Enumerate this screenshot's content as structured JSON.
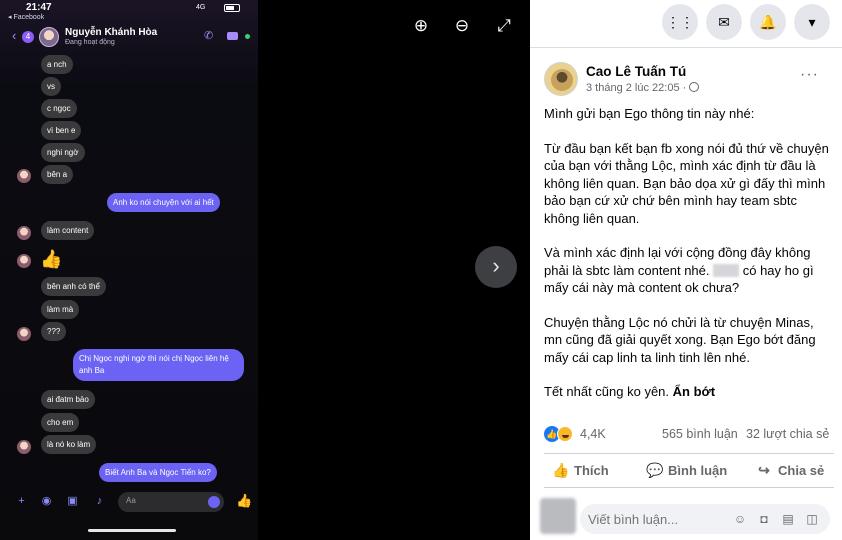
{
  "phone": {
    "time": "21:47",
    "back_app": "◂ Facebook",
    "network": "4G",
    "unread_count": "4",
    "contact_name": "Nguyễn Khánh Hòa",
    "contact_status": "Đang hoạt động",
    "messages": [
      {
        "text": "a nch",
        "dir": "in"
      },
      {
        "text": "vs",
        "dir": "in"
      },
      {
        "text": "c ngọc",
        "dir": "in"
      },
      {
        "text": "vì ben e",
        "dir": "in"
      },
      {
        "text": "nghi ngờ",
        "dir": "in"
      },
      {
        "text": "bên a",
        "dir": "in"
      },
      {
        "text": "Anh ko nói chuyện với ai hết",
        "dir": "out"
      },
      {
        "text": "làm content",
        "dir": "in"
      },
      {
        "text": "bên anh có thể",
        "dir": "in"
      },
      {
        "text": "làm mà",
        "dir": "in"
      },
      {
        "text": "???",
        "dir": "in"
      },
      {
        "text": "Chị Ngọc nghi ngờ thì nói chị Ngọc liên hệ anh Ba",
        "dir": "out"
      },
      {
        "text": "ai đatm bảo",
        "dir": "in"
      },
      {
        "text": "cho em",
        "dir": "in"
      },
      {
        "text": "là nó ko làm",
        "dir": "in"
      },
      {
        "text": "Biết Anh Ba và Ngọc Tiến ko?",
        "dir": "out"
      }
    ],
    "composer_placeholder": "Aa"
  },
  "post": {
    "author": "Cao Lê Tuấn Tú",
    "timestamp": "3 tháng 2 lúc 22:05 ·",
    "paragraphs": [
      "Mình gửi bạn Ego thông tin này nhé:",
      "Từ đầu bạn kết bạn fb xong nói đủ thứ về chuyện của bạn với thằng Lộc, mình xác định từ đầu là không liên quan. Bạn bảo dọa xử gì đấy thì mình bảo bạn cứ xử chứ bên mình hay team sbtc không liên quan.",
      "Và mình xác định lại với cộng đồng đây không phải là sbtc làm content nhé."
    ],
    "paragraph3_tail": " có hay ho gì mấy cái này mà content ok chưa?",
    "paragraph4": "Chuyện thằng Lộc nó chửi là từ chuyện Minas, mn cũng đã giải quyết xong. Bạn Ego bớt đăng mấy cái cap linh ta linh tinh lên nhé.",
    "paragraph5": "Tết nhất cũng ko yên.",
    "see_less": "Ẩn bớt",
    "reaction_count": "4,4K",
    "comments_count": "565 bình luận",
    "shares_count": "32 lượt chia sẻ",
    "actions": {
      "like": "Thích",
      "comment": "Bình luận",
      "share": "Chia sẻ"
    },
    "comment_placeholder": "Viết bình luận..."
  },
  "colors": {
    "messenger_accent": "#6c63f5",
    "facebook_blue": "#1877f2",
    "haha_yellow": "#f7b928"
  }
}
